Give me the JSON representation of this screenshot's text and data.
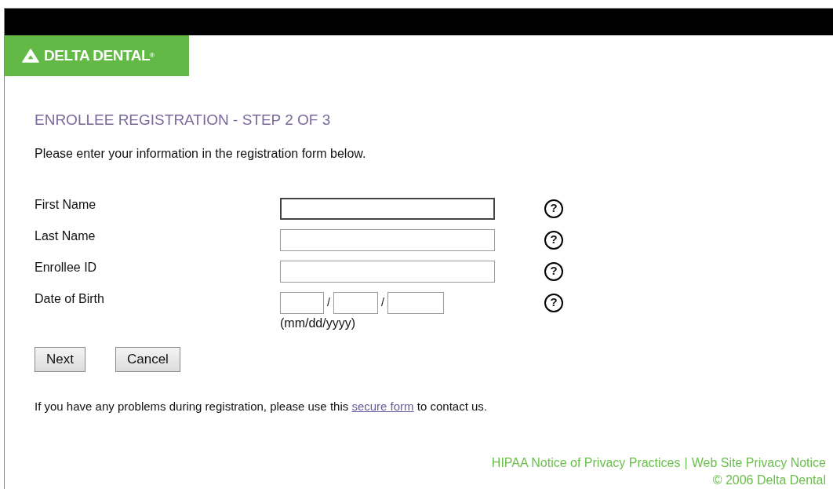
{
  "logo": {
    "text": "DELTA DENTAL",
    "mark": "®"
  },
  "title": "ENROLLEE REGISTRATION - STEP 2 OF 3",
  "intro": "Please enter your information in the registration form below.",
  "fields": [
    {
      "kind": "text",
      "label": "First Name",
      "focused": true
    },
    {
      "kind": "text",
      "label": "Last Name",
      "focused": false
    },
    {
      "kind": "text",
      "label": "Enrollee ID",
      "focused": false
    },
    {
      "kind": "date",
      "label": "Date of Birth",
      "focused": false,
      "separators": [
        "/",
        "/"
      ],
      "hint": "(mm/dd/yyyy)"
    }
  ],
  "help_glyph": "?",
  "buttons": [
    "Next",
    "Cancel"
  ],
  "contact": {
    "before": "If you have any problems during registration, please use this ",
    "link": "secure form",
    "after": " to contact us."
  },
  "footer": {
    "links": [
      "HIPAA Notice of Privacy Practices",
      "Web Site Privacy Notice"
    ],
    "separator": "|",
    "copyright": "© 2006 Delta Dental"
  }
}
